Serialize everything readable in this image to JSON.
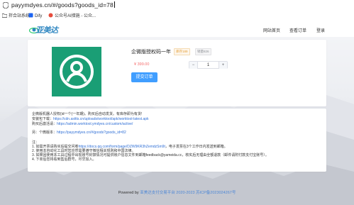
{
  "browser": {
    "url": "payymdyes.cn/#/goods?goods_id=78",
    "bookmarks": [
      {
        "label": "拌合站系统",
        "icon": "folder-icon"
      },
      {
        "label": "Dify",
        "icon": "dify-icon"
      },
      {
        "label": "公众号AI措施 - 公众...",
        "icon": "wechat-icon"
      }
    ]
  },
  "header": {
    "logo_text": "亚美达",
    "nav": [
      "网站首页",
      "查看订单",
      "登录"
    ]
  },
  "product": {
    "title": "企微版授权码一年",
    "sales_badge": "库存189",
    "stock_badge": "销量826",
    "price": "¥ 399.00",
    "quantity": "1",
    "minus": "−",
    "plus": "+",
    "submit_label": "提交订单",
    "image_icon": "user-avatar-icon",
    "image_color": "#1a9e75"
  },
  "description": {
    "l1": "企微版机器人授权(id一个(一年期)。购买后自动发货。有库存即为有货!",
    "l2_label": "安装包下载：",
    "l2_link": "https://cdn.asttts.cn/uploads/worktool/apk/worktool-latest.apk",
    "l3_label": "购买后激活请：",
    "l3_link": "https://admin.worktool.ymdyes.cn/custom/active/",
    "l4_label": "另：个微版本：",
    "l4_link": "https://payymdyes.cn/#/goods?goods_id=82",
    "note_title": "注：",
    "n1_a": "1. 如需开票请购买后提交问卷",
    "n1_link": "https://docs.qq.com/form/page/DZW9KR3hZemdzSm9t",
    "n1_b": "，电子发票在3个工作日内发送到邮箱。",
    "n2": "2. 使用本自动化工具时您应然需要遵守微信相关规则和中国法律。",
    "n3": "3. 如果因使用本工具过程中出现账号封禁情况可提供账户信息文件到邮箱feedback@yameida.cc，核实后无理由全额退款（邮件请附付款支付宝账号）。",
    "n4": "4. 下单后您将看到售后群号，尽早加入。"
  },
  "footer": {
    "powered": "Powered by",
    "brand": "亚美达支付交易平台",
    "copyright": "2020-2023 苏ICP备2023024267号"
  }
}
